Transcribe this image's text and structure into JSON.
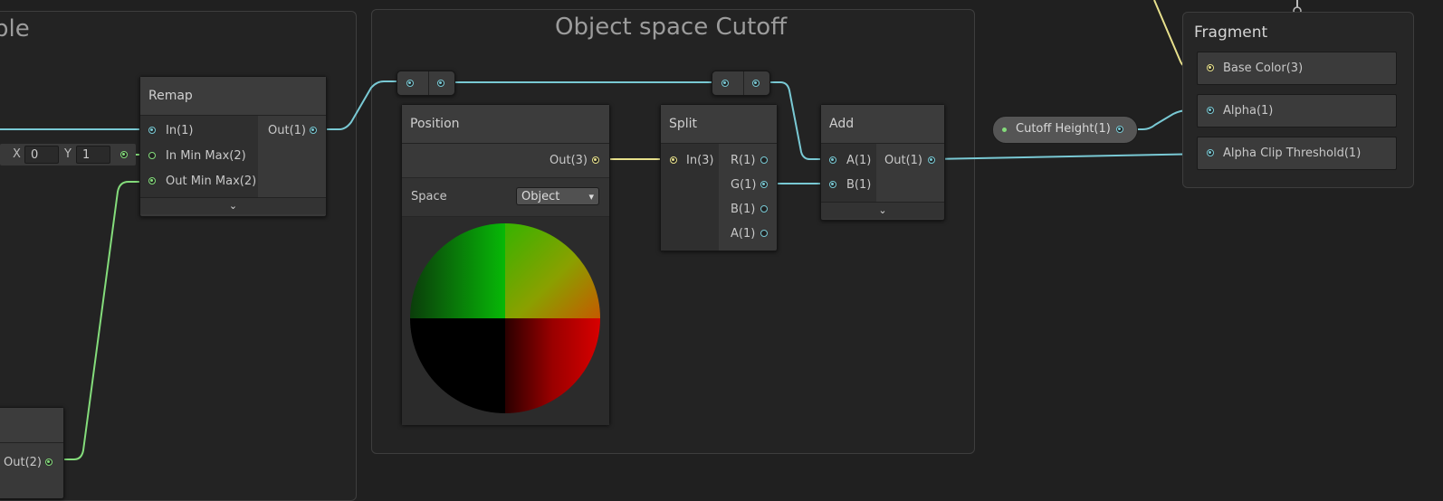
{
  "groups": {
    "left_title": "ble",
    "cutoff_title": "Object space Cutoff"
  },
  "remap": {
    "title": "Remap",
    "in": "In(1)",
    "in_min_max": "In Min Max(2)",
    "out_min_max": "Out Min Max(2)",
    "out": "Out(1)",
    "vector_field": {
      "x_label": "X",
      "x_value": "0",
      "y_label": "Y",
      "y_value": "1"
    }
  },
  "partial_node": {
    "out": "Out(2)"
  },
  "position": {
    "title": "Position",
    "out": "Out(3)",
    "space_label": "Space",
    "space_value": "Object",
    "dropdown_arrow": "▾"
  },
  "split": {
    "title": "Split",
    "in": "In(3)",
    "outputs": [
      "R(1)",
      "G(1)",
      "B(1)",
      "A(1)"
    ]
  },
  "add": {
    "title": "Add",
    "a": "A(1)",
    "b": "B(1)",
    "out": "Out(1)"
  },
  "property": {
    "label": "Cutoff Height(1)"
  },
  "fragment": {
    "title": "Fragment",
    "base_color": "Base Color(3)",
    "alpha": "Alpha(1)",
    "alpha_clip": "Alpha Clip Threshold(1)"
  },
  "expander_glyph": "⌄",
  "colors": {
    "wire_float": "#79c9d4",
    "wire_vec3": "#e7e08c",
    "wire_vec2": "#84dc7b",
    "background": "#202020",
    "node": "#393939"
  }
}
